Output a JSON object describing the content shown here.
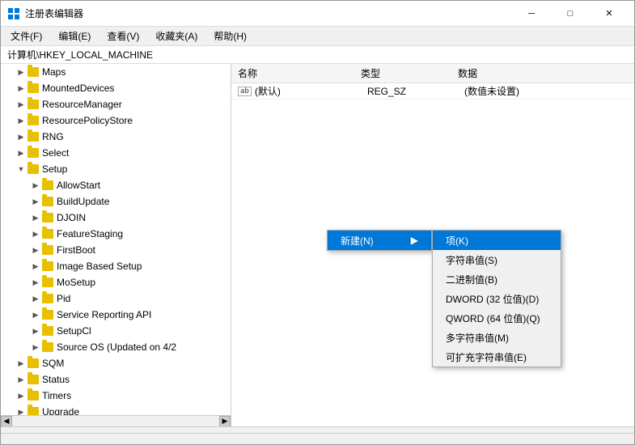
{
  "window": {
    "title": "注册表编辑器",
    "icon": "regedit-icon"
  },
  "title_controls": {
    "minimize": "─",
    "maximize": "□",
    "close": "✕"
  },
  "menu": {
    "items": [
      {
        "label": "文件(F)"
      },
      {
        "label": "编辑(E)"
      },
      {
        "label": "查看(V)"
      },
      {
        "label": "收藏夹(A)"
      },
      {
        "label": "帮助(H)"
      }
    ]
  },
  "breadcrumb": "计算机\\HKEY_LOCAL_MACHINE",
  "tree": {
    "items": [
      {
        "label": "Maps",
        "indent": 1,
        "expanded": false
      },
      {
        "label": "MountedDevices",
        "indent": 1,
        "expanded": false
      },
      {
        "label": "ResourceManager",
        "indent": 1,
        "expanded": false
      },
      {
        "label": "ResourcePolicyStore",
        "indent": 1,
        "expanded": false
      },
      {
        "label": "RNG",
        "indent": 1,
        "expanded": false
      },
      {
        "label": "Select",
        "indent": 1,
        "expanded": false
      },
      {
        "label": "Setup",
        "indent": 1,
        "expanded": true,
        "selected": false
      },
      {
        "label": "AllowStart",
        "indent": 2,
        "expanded": false
      },
      {
        "label": "BuildUpdate",
        "indent": 2,
        "expanded": false
      },
      {
        "label": "DJOIN",
        "indent": 2,
        "expanded": false
      },
      {
        "label": "FeatureStaging",
        "indent": 2,
        "expanded": false
      },
      {
        "label": "FirstBoot",
        "indent": 2,
        "expanded": false
      },
      {
        "label": "Image Based Setup",
        "indent": 2,
        "expanded": false
      },
      {
        "label": "MoSetup",
        "indent": 2,
        "expanded": false
      },
      {
        "label": "Pid",
        "indent": 2,
        "expanded": false
      },
      {
        "label": "Service Reporting API",
        "indent": 2,
        "expanded": false
      },
      {
        "label": "SetupCl",
        "indent": 2,
        "expanded": false
      },
      {
        "label": "Source OS (Updated on 4/2",
        "indent": 2,
        "expanded": false
      },
      {
        "label": "SQM",
        "indent": 1,
        "expanded": false
      },
      {
        "label": "Status",
        "indent": 1,
        "expanded": false
      },
      {
        "label": "Timers",
        "indent": 1,
        "expanded": false
      },
      {
        "label": "Upgrade",
        "indent": 1,
        "expanded": false
      }
    ]
  },
  "table": {
    "columns": [
      "名称",
      "类型",
      "数据"
    ],
    "rows": [
      {
        "name": "(默认)",
        "type": "REG_SZ",
        "data": "(数值未设置)",
        "icon": "ab"
      }
    ]
  },
  "context_menu": {
    "items": [
      {
        "label": "新建(N)",
        "arrow": "▶",
        "active": true
      }
    ]
  },
  "submenu": {
    "items": [
      {
        "label": "项(K)",
        "highlighted": true
      },
      {
        "label": "字符串值(S)",
        "highlighted": false
      },
      {
        "label": "二进制值(B)",
        "highlighted": false
      },
      {
        "label": "DWORD (32 位值)(D)",
        "highlighted": false
      },
      {
        "label": "QWORD (64 位值)(Q)",
        "highlighted": false
      },
      {
        "label": "多字符串值(M)",
        "highlighted": false
      },
      {
        "label": "可扩充字符串值(E)",
        "highlighted": false
      }
    ]
  }
}
